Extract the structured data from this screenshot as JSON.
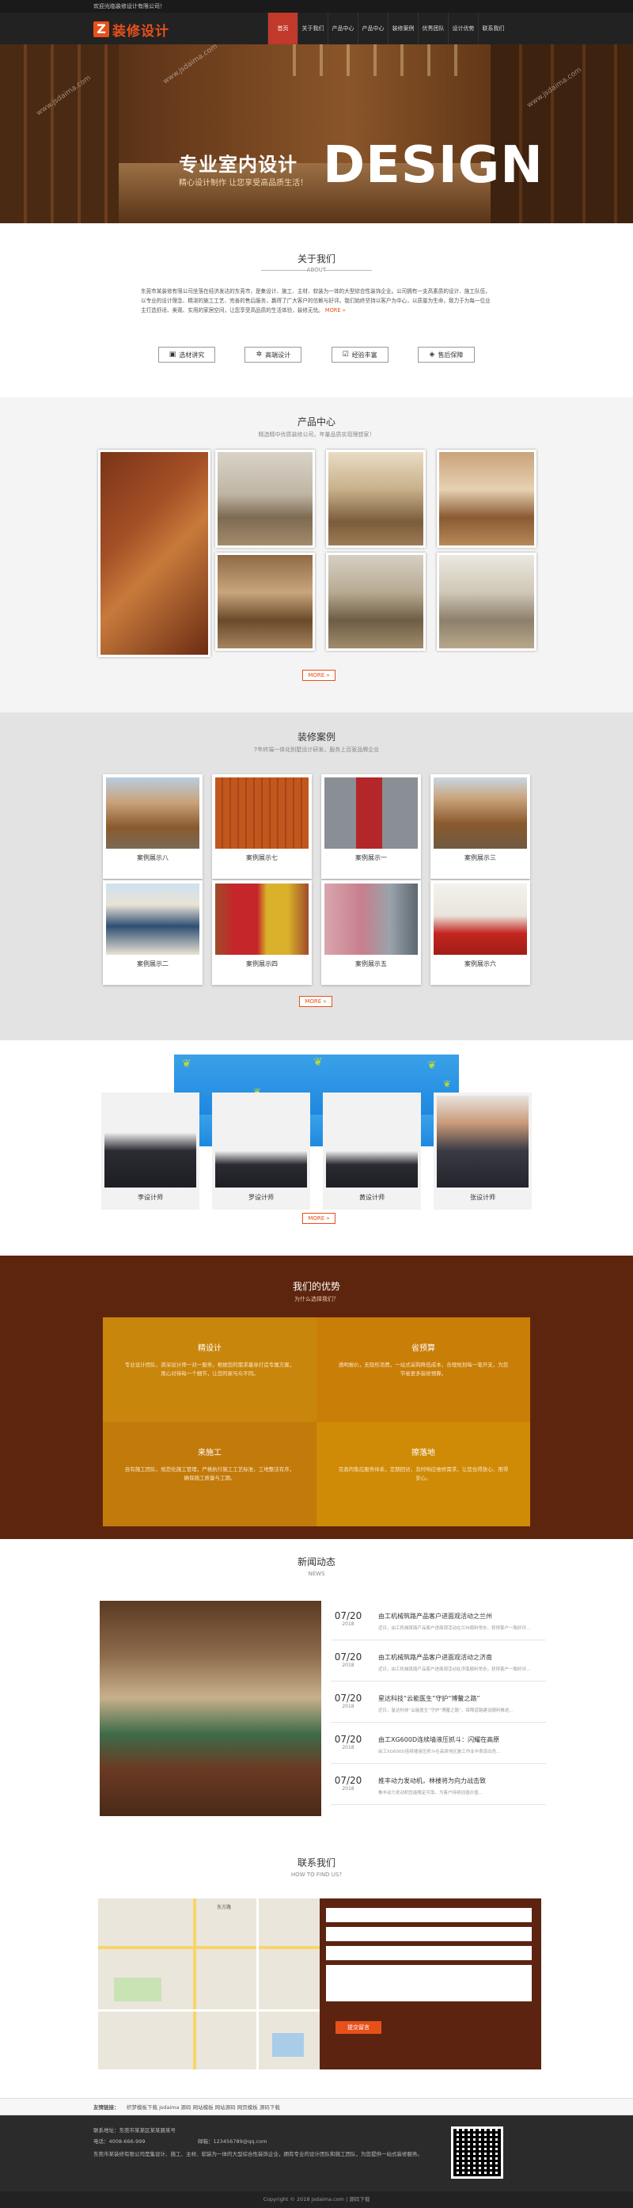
{
  "topbar": {
    "welcome": "欢迎光临装修设计有限公司！"
  },
  "logo": {
    "mark": "Z",
    "text": "装修设计"
  },
  "nav": [
    "首页",
    "关于我们",
    "产品中心",
    "产品中心",
    "装修案例",
    "优秀团队",
    "设计优势",
    "联系我们"
  ],
  "hero": {
    "title": "专业室内设计",
    "design": "DESIGN",
    "slogan": "精心设计制作  让您享受高品质生活！",
    "watermark": "www.jsdaima.com"
  },
  "about": {
    "title": "关于我们",
    "sub": "ABOUT",
    "text": "东莞市某装修有限公司坐落在经济发达的东莞市，是集设计、施工、主材、软装为一体的大型综合性装饰企业。公司拥有一支高素质的设计、施工队伍，以专业的设计理念、精湛的施工工艺、完善的售后服务，赢得了广大客户的信赖与好评。我们始终坚持以客户为中心，以质量为生命，致力于为每一位业主打造舒适、美观、实用的家居空间，让您享受高品质的生活体验，装修无忧。",
    "more": "MORE »",
    "buttons": [
      {
        "icon": "box",
        "label": "选材讲究"
      },
      {
        "icon": "gear",
        "label": "高端设计"
      },
      {
        "icon": "check",
        "label": "经验丰富"
      },
      {
        "icon": "shield",
        "label": "售后保障"
      }
    ]
  },
  "products": {
    "title": "产品中心",
    "sub": "精选精中优质装修公司，年量品质实现理想家！",
    "more": "MORE »"
  },
  "cases": {
    "title": "装修案例",
    "sub": "7年终端一体化别墅设计研发，服务上百家品牌企业",
    "more": "MORE »",
    "items": [
      "案例展示八",
      "案例展示七",
      "案例展示一",
      "案例展示三",
      "案例展示二",
      "案例展示四",
      "案例展示五",
      "案例展示六"
    ]
  },
  "designers": {
    "more": "MORE »",
    "items": [
      "李设计师",
      "罗设计师",
      "黄设计师",
      "张设计师"
    ]
  },
  "advantages": {
    "title": "我们的优势",
    "sub": "为什么选择我们？",
    "boxes": [
      {
        "title": "精设计",
        "text": "专业设计团队，资深设计师一对一服务，根据您的需求量身打造专属方案，用心对待每一个细节，让您的家与众不同。"
      },
      {
        "title": "省预算",
        "text": "透明报价，无隐形消费，一站式采购降低成本，合理规划每一笔开支，为您节省更多装修预算。"
      },
      {
        "title": "来施工",
        "text": "自有施工团队，规范化施工管理，严格执行施工工艺标准，工地整洁有序，确保施工质量与工期。"
      },
      {
        "title": "擦落地",
        "text": "完善的售后服务体系，定期回访，及时响应维修需求，让您住得放心、用得安心。"
      }
    ]
  },
  "news": {
    "title": "新闻动态",
    "sub": "NEWS",
    "items": [
      {
        "day": "07/20",
        "year": "2018",
        "title": "由工机械筑路产品客户进面观活动之兰州",
        "summary": "近日，由工机械筑路产品客户进面观活动在兰州顺利举办，获得客户一致好评..."
      },
      {
        "day": "07/20",
        "year": "2018",
        "title": "由工机械筑路产品客户进面观活动之济南",
        "summary": "近日，由工机械筑路产品客户进面观活动在济南顺利举办，获得客户一致好评..."
      },
      {
        "day": "07/20",
        "year": "2018",
        "title": "星达科技“云能医生”守护“博鳌之路”",
        "summary": "近日，星达科技“云能医生”守护“博鳌之路”，保障道路建设顺利推进..."
      },
      {
        "day": "07/20",
        "year": "2018",
        "title": "由工XG600D连续墙液压抓斗：闪耀在高原",
        "summary": "由工XG600D连续墙液压抓斗在高原地区施工作业中表现出色..."
      },
      {
        "day": "07/20",
        "year": "2018",
        "title": "推丰动力发动机，林楼将为向力战击致",
        "summary": "推丰动力发动机性能稳定可靠，为客户持续创造价值..."
      }
    ]
  },
  "contact": {
    "title": "联系我们",
    "sub": "HOW TO FIND US?",
    "map_label": "东方路",
    "submit": "提交留言"
  },
  "links": {
    "label": "友情链接：",
    "items": "织梦模板下载 jsdaima 源码 网站模板 网站源码 网页模板 源码下载"
  },
  "footer": {
    "address": "联系地址：东莞市某某区某某路某号",
    "phone": "电话：4008-666-999",
    "email": "邮箱：123456789@qq.com",
    "desc": "东莞市某装修有限公司是集设计、施工、主材、软装为一体的大型综合性装饰企业，拥有专业的设计团队和施工团队，为您提供一站式装修服务。",
    "copyright": "Copyright © 2018 jsdaima.com | 源码下载"
  }
}
